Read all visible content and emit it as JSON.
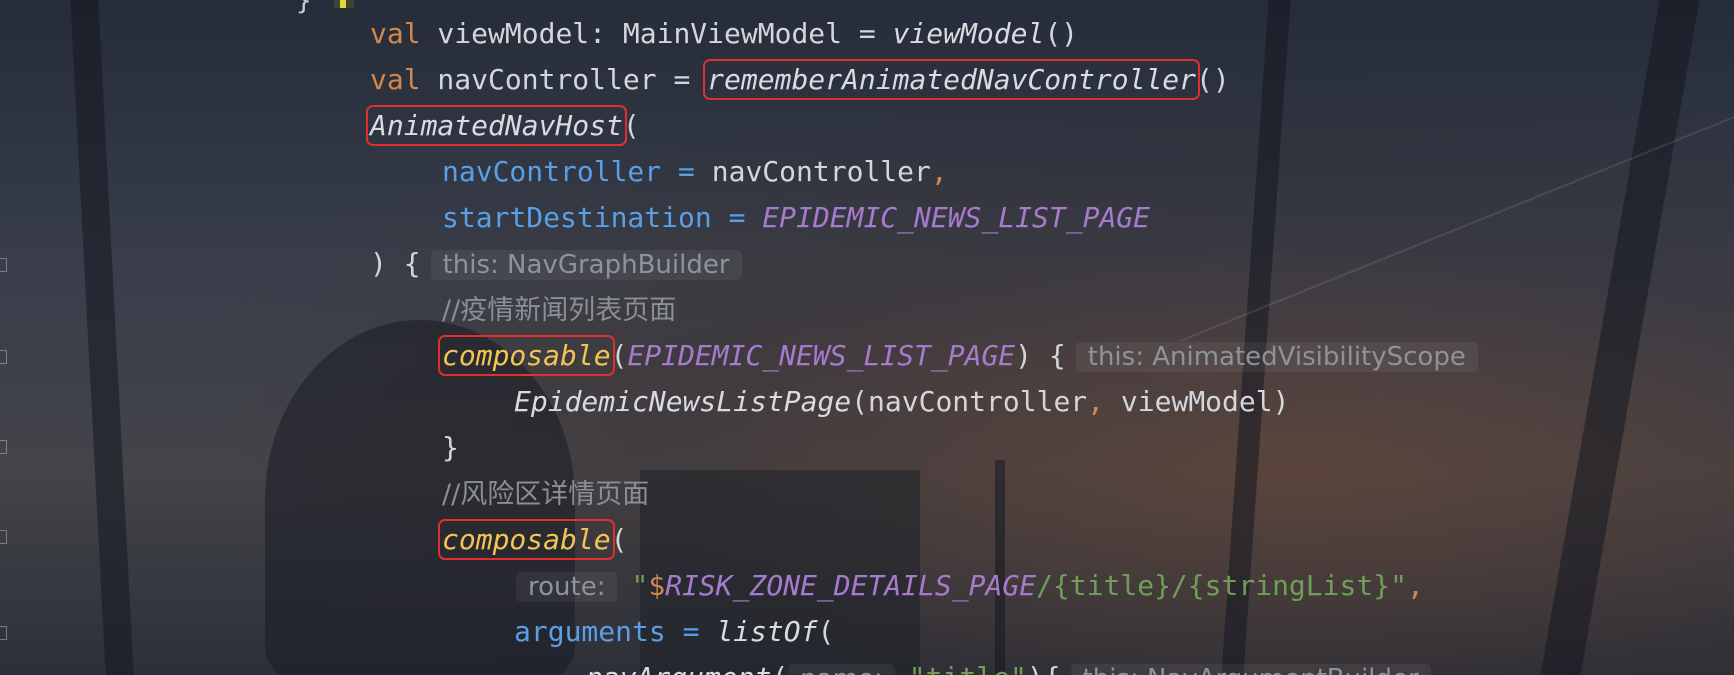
{
  "editor": {
    "language": "Kotlin",
    "top_fragment": "}",
    "lines": {
      "l1": {
        "kw": "val",
        "a": " viewModel: MainViewModel = ",
        "fn": "viewModel",
        "b": "()"
      },
      "l2": {
        "kw": "val",
        "a": " navController = ",
        "fn": "rememberAnimatedNavController",
        "b": "()"
      },
      "l3": {
        "fn": "AnimatedNavHost",
        "b": "("
      },
      "l4": {
        "param": "navController",
        "eq": " = ",
        "val": "navController",
        "comma": ","
      },
      "l5": {
        "param": "startDestination",
        "eq": " = ",
        "const": "EPIDEMIC_NEWS_LIST_PAGE"
      },
      "l6": {
        "a": ") {",
        "hint": "this: NavGraphBuilder"
      },
      "l7": {
        "comment": "//疫情新闻列表页面"
      },
      "l8": {
        "comp": "composable",
        "b": "(",
        "const": "EPIDEMIC_NEWS_LIST_PAGE",
        "c": ") {",
        "hint": "this: AnimatedVisibilityScope"
      },
      "l9": {
        "fn": "EpidemicNewsListPage",
        "a": "(navController",
        "comma": ",",
        "b": " viewModel)"
      },
      "l10": {
        "a": "}"
      },
      "l11": {
        "comment": "//风险区详情页面"
      },
      "l12": {
        "comp": "composable",
        "b": "("
      },
      "l13": {
        "hint": "route:",
        "q": "\"",
        "dollar": "$",
        "const": "RISK_ZONE_DETAILS_PAGE",
        "str": "/{title}/{stringList}\"",
        "comma": ","
      },
      "l14": {
        "param": "arguments",
        "eq": " = ",
        "fn": "listOf",
        "b": "("
      },
      "l15": {
        "fn": "navArgument",
        "b": "(",
        "hint": "name:",
        "str": "\"title\"",
        "c": "){",
        "hint2": "this: NavArgumentBuilder"
      }
    }
  }
}
